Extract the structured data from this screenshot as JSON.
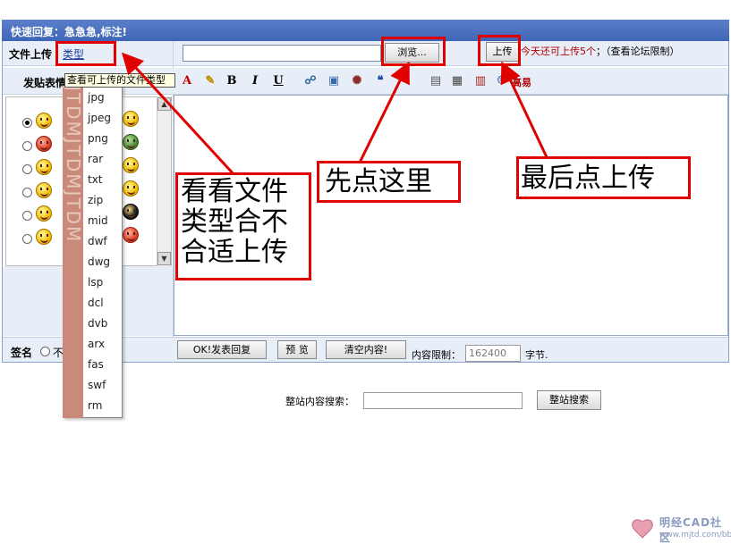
{
  "window": {
    "title": "快速回复：急急急,标注!"
  },
  "upload": {
    "label": "文件上传",
    "type_link": "类型",
    "browse_label": "浏览...",
    "upload_label": "上传",
    "info_prefix": "今天还可上传5个",
    "info_suffix": "；（查看论坛限制）"
  },
  "toolbar": {
    "post_label": "发贴表情",
    "more_label": "高易",
    "buttons": [
      {
        "name": "font-color-icon",
        "glyph": "A"
      },
      {
        "name": "highlight-icon",
        "glyph": "✎"
      },
      {
        "name": "bold-icon",
        "glyph": "B"
      },
      {
        "name": "italic-icon",
        "glyph": "I"
      },
      {
        "name": "underline-icon",
        "glyph": "U"
      },
      {
        "name": "link-icon",
        "glyph": "☍"
      },
      {
        "name": "image-icon",
        "glyph": "▣"
      },
      {
        "name": "flash-icon",
        "glyph": "✺"
      },
      {
        "name": "quote-icon",
        "glyph": "❝"
      },
      {
        "name": "code-icon",
        "glyph": "▤"
      },
      {
        "name": "media-icon",
        "glyph": "▦"
      },
      {
        "name": "table-icon",
        "glyph": "▥"
      },
      {
        "name": "smiley-icon",
        "glyph": "☺"
      }
    ]
  },
  "file_types": {
    "tooltip": "查看可上传的文件类型",
    "items": [
      "jpg",
      "jpeg",
      "png",
      "rar",
      "txt",
      "zip",
      "mid",
      "dwf",
      "dwg",
      "lsp",
      "dcl",
      "dvb",
      "arx",
      "fas",
      "swf",
      "rm"
    ],
    "watermark": "JTDMJTDMJTDM"
  },
  "bottom": {
    "sign_label": "签名",
    "sign_option": "不",
    "submit_label": "OK!发表回复",
    "preview_label": "预 览",
    "clear_label": "清空内容!",
    "limit_label": "内容限制：",
    "limit_value": "162400",
    "bytes_label": "字节."
  },
  "site_search": {
    "label": "整站内容搜索：",
    "button_label": "整站搜索"
  },
  "annotations": {
    "check_types": "看看文件类型合不合适上传",
    "click_here_first": "先点这里",
    "click_upload_last": "最后点上传"
  },
  "logo": {
    "name": "明经CAD社区",
    "url": "www.mjtd.com/bbs"
  },
  "colors": {
    "title_bar": "#4a6fc0",
    "annotation_red": "#e00000",
    "info_red": "#b00000",
    "panel_bg": "#e8eef7"
  }
}
